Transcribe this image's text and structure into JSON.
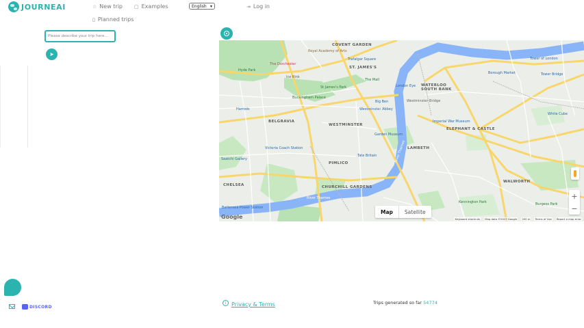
{
  "brand": {
    "name": "JOURNEAI"
  },
  "nav": {
    "new_trip": "New trip",
    "examples": "Examples",
    "planned_trips": "Planned trips",
    "login": "Log in"
  },
  "language": {
    "selected": "English"
  },
  "prompt": {
    "placeholder": "Please describe your trip here..."
  },
  "map": {
    "type_map": "Map",
    "type_satellite": "Satellite",
    "zoom_in": "+",
    "zoom_out": "−",
    "google": "Google",
    "footer": {
      "shortcuts": "Keyboard shortcuts",
      "data": "Map data ©2023 Google",
      "scale": "200 m",
      "terms": "Terms of Use",
      "report": "Report a map error"
    },
    "areas": [
      "COVENT GARDEN",
      "ST. JAMES'S",
      "WATERLOO",
      "SOUTH BANK",
      "BELGRAVIA",
      "WESTMINSTER",
      "LAMBETH",
      "PIMLICO",
      "CHURCHILL GARDENS",
      "CHELSEA",
      "WALWORTH",
      "ELEPHANT & CASTLE"
    ],
    "pois": [
      "Royal Academy of Arts",
      "Trafalgar Square",
      "The Mall",
      "The Dorchester",
      "Hyde Park",
      "Buckingham Palace",
      "St James's Park",
      "London Eye",
      "Big Ben",
      "Westminster Abbey",
      "Westminster Bridge",
      "Imperial War Museum",
      "Harrods",
      "Victoria Coach Station",
      "Tate Britain",
      "Garden Museum",
      "Saatchi Gallery",
      "Battersea Power Station",
      "Borough Market",
      "Tower of London",
      "Tower Bridge",
      "White Cube",
      "Kennington Park",
      "Burgess Park",
      "Ice Rink"
    ],
    "river": [
      "River Thames",
      "River Thames"
    ]
  },
  "footer": {
    "privacy": "Privacy & Terms",
    "trips_prefix": "Trips generated so far",
    "trips_count": "54774",
    "discord": "DISCORD"
  }
}
